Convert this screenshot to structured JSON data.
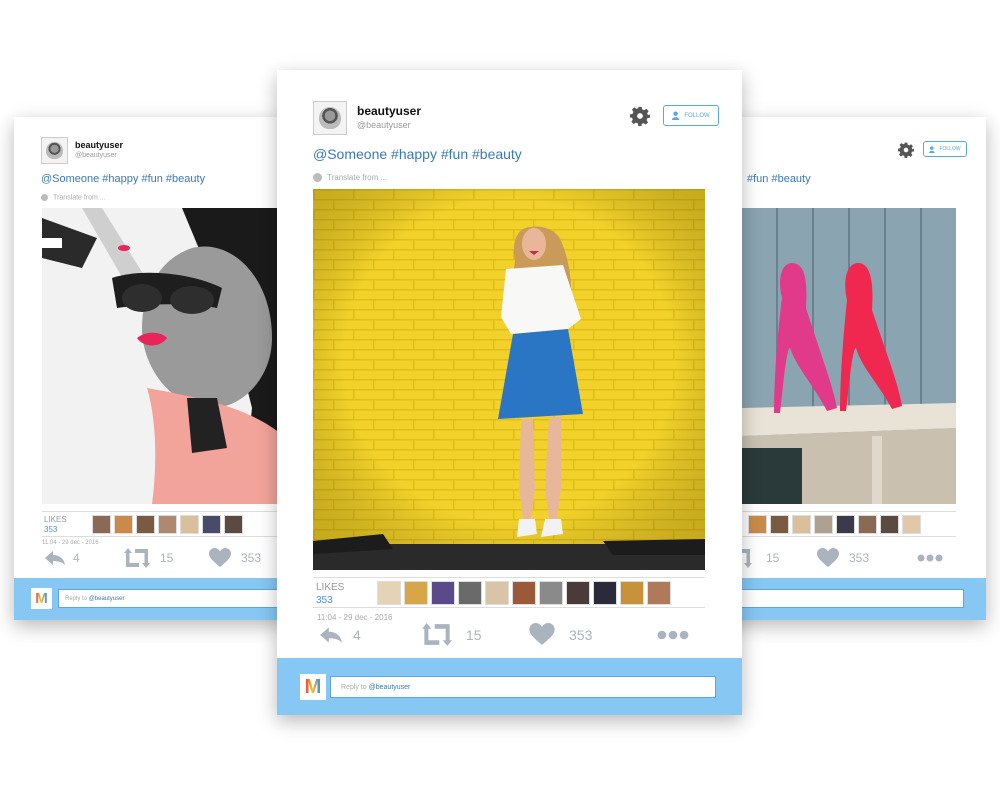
{
  "cards": {
    "left": {
      "username": "beautyuser",
      "handle": "@beautyuser",
      "text": "@Someone #happy #fun #beauty",
      "translate": "Translate from ...",
      "likes_label": "LIKES",
      "likes_count": "353",
      "timestamp": "11:04 - 29 dec - 2016",
      "reply_count": "4",
      "retweet_count": "15",
      "like_count": "353",
      "reply_prefix": "Reply to",
      "reply_handle": "@beautyuser"
    },
    "center": {
      "username": "beautyuser",
      "handle": "@beautyuser",
      "follow_label": "FOLLOW",
      "text": "@Someone #happy #fun #beauty",
      "translate": "Translate from ...",
      "likes_label": "LIKES",
      "likes_count": "353",
      "timestamp": "11:04 - 29 dec - 2016",
      "reply_count": "4",
      "retweet_count": "15",
      "like_count": "353",
      "reply_prefix": "Reply to",
      "reply_handle": "@beautyuser",
      "logo": "M"
    },
    "right": {
      "follow_label": "FOLLOW",
      "text": "#fun #beauty",
      "retweet_count": "15",
      "like_count": "353"
    }
  },
  "colors": {
    "accent": "#3a79b8",
    "reply_bar": "#86c7f3",
    "follow": "#5aa6e6",
    "icon": "#aab4bf"
  },
  "icons": [
    "gear-icon",
    "follow-user-icon",
    "reply-icon",
    "retweet-icon",
    "heart-icon",
    "more-icon",
    "globe-icon"
  ]
}
